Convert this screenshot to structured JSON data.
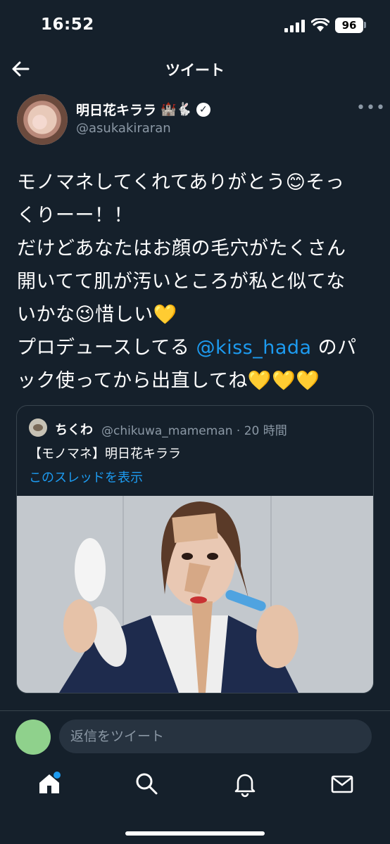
{
  "status_bar": {
    "time": "16:52",
    "battery": "96"
  },
  "nav": {
    "title": "ツイート"
  },
  "author": {
    "name": "明日花キララ",
    "name_emoji": "🏰🐇",
    "handle": "@asukakiraran"
  },
  "tweet": {
    "lines": [
      "モノマネしてくれてありがとう😊そっ",
      "くりーー！！",
      "だけどあなたはお顔の毛穴がたくさん",
      "開いてて肌が汚いところが私と似てな",
      "いかな😉惜しい💛"
    ],
    "line6_before": "プロデュースしてる ",
    "mention": "@kiss_hada",
    "line6_after": " のパ",
    "line7": "ック使ってから出直してね💛💛💛"
  },
  "quote": {
    "name": "ちくわ",
    "handle_time": "@chikuwa_mameman · 20 時間",
    "text": "【モノマネ】明日花キララ",
    "thread_link": "このスレッドを表示"
  },
  "reply": {
    "placeholder": "返信をツイート"
  },
  "colors": {
    "background": "#15202b",
    "accent": "#1d9bf0",
    "secondary_text": "#8b98a5",
    "border": "#38444d"
  }
}
